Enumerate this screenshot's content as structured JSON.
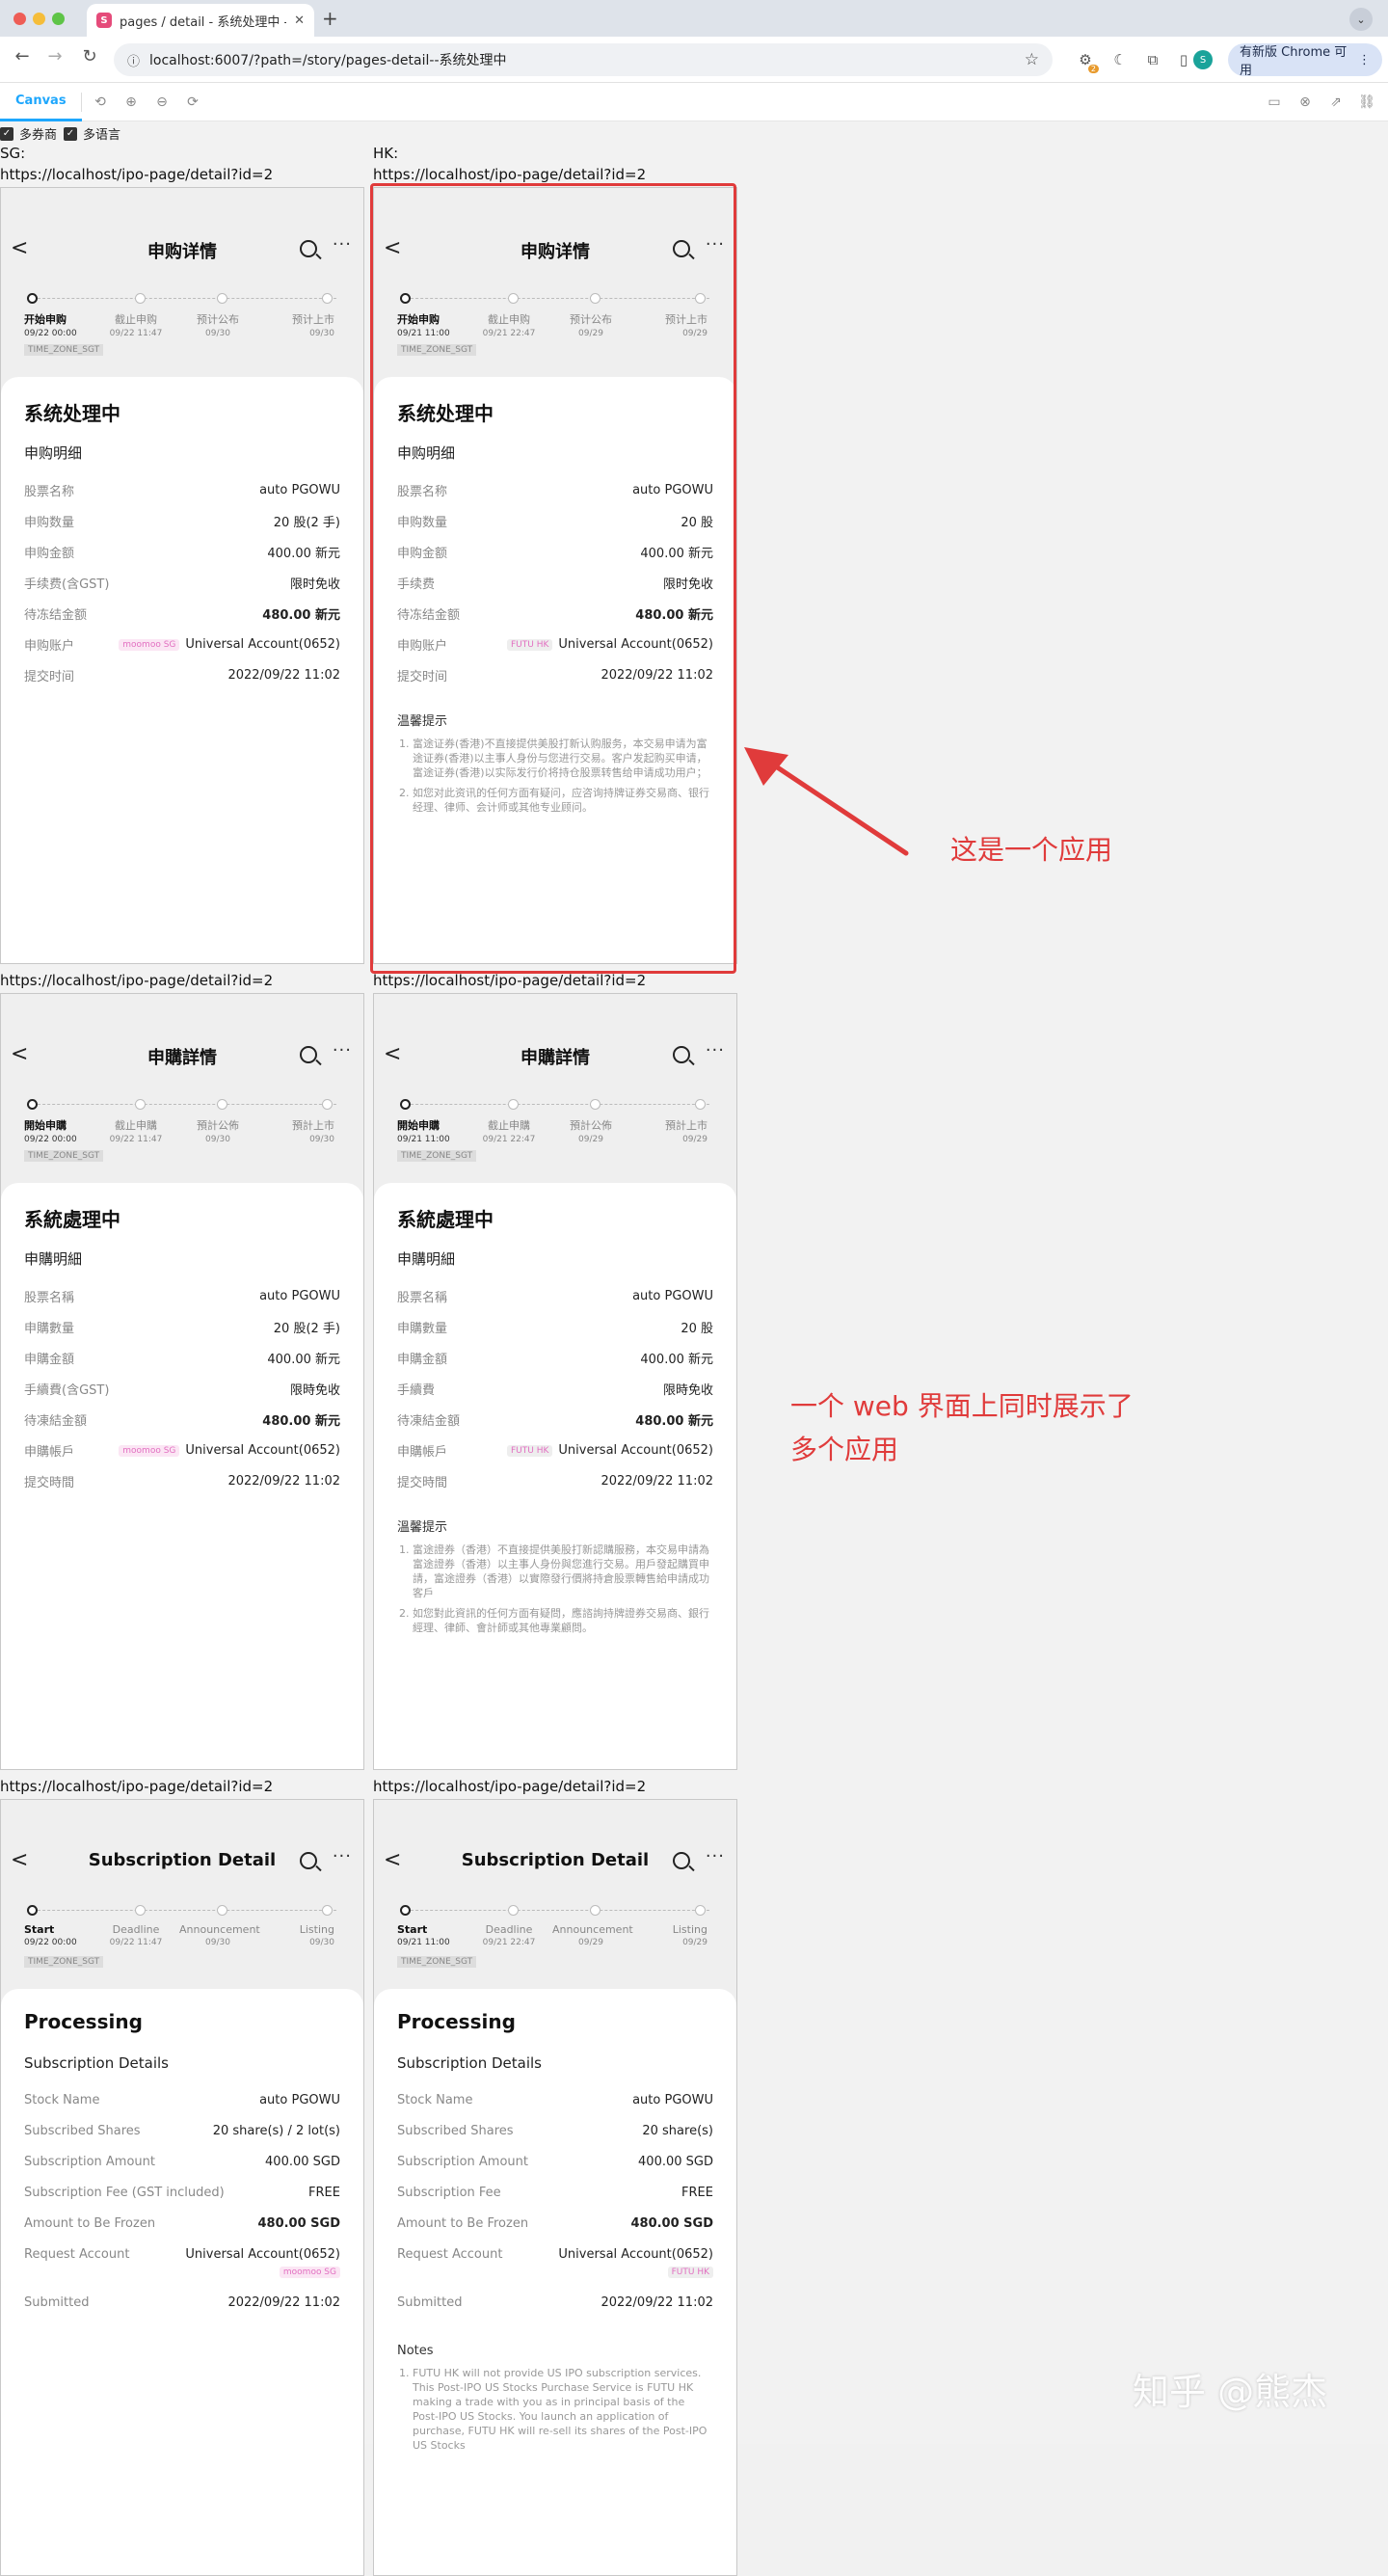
{
  "browser": {
    "tab_title": "pages / detail - 系统处理中 - S",
    "tab_favicon": "S",
    "url": "localhost:6007/?path=/story/pages-detail--系统处理中",
    "update_label": "有新版 Chrome 可用",
    "profile_initial": "S",
    "ext_badge": "2"
  },
  "storybook": {
    "canvas_tab": "Canvas"
  },
  "toggles": [
    {
      "label": "多券商",
      "checked": true
    },
    {
      "label": "多语言",
      "checked": true
    }
  ],
  "labels": {
    "sg": "SG:",
    "hk": "HK:",
    "url": "https://localhost/ipo-page/detail?id=2"
  },
  "frames": [
    {
      "title": "申购详情",
      "steps": [
        {
          "name": "开始申购",
          "date": "09/22 00:00"
        },
        {
          "name": "截止申购",
          "date": "09/22 11:47"
        },
        {
          "name": "预计公布",
          "date": "09/30"
        },
        {
          "name": "预计上市",
          "date": "09/30"
        }
      ],
      "tz": "TIME_ZONE_SGT",
      "status": "系统处理中",
      "section": "申购明细",
      "rows": [
        {
          "k": "股票名称",
          "v": "auto PGOWU"
        },
        {
          "k": "申购数量",
          "v": "20 股(2 手)"
        },
        {
          "k": "申购金额",
          "v": "400.00 新元"
        },
        {
          "k": "手续费(含GST)",
          "v": "限时免收"
        },
        {
          "k": "待冻结金额",
          "v": "480.00 新元",
          "bold": true
        },
        {
          "k": "申购账户",
          "v": "Universal Account(0652)",
          "badge": "moomoo SG"
        },
        {
          "k": "提交时间",
          "v": "2022/09/22 11:02"
        }
      ]
    },
    {
      "title": "申购详情",
      "steps": [
        {
          "name": "开始申购",
          "date": "09/21 11:00"
        },
        {
          "name": "截止申购",
          "date": "09/21 22:47"
        },
        {
          "name": "预计公布",
          "date": "09/29"
        },
        {
          "name": "预计上市",
          "date": "09/29"
        }
      ],
      "tz": "TIME_ZONE_SGT",
      "status": "系统处理中",
      "section": "申购明细",
      "rows": [
        {
          "k": "股票名称",
          "v": "auto PGOWU"
        },
        {
          "k": "申购数量",
          "v": "20 股"
        },
        {
          "k": "申购金额",
          "v": "400.00 新元"
        },
        {
          "k": "手续费",
          "v": "限时免收"
        },
        {
          "k": "待冻结金额",
          "v": "480.00 新元",
          "bold": true
        },
        {
          "k": "申购账户",
          "v": "Universal Account(0652)",
          "badge": "FUTU HK"
        },
        {
          "k": "提交时间",
          "v": "2022/09/22 11:02"
        }
      ],
      "tips_title": "温馨提示",
      "tips": [
        "富途证券(香港)不直接提供美股打新认购服务，本交易申请为富途证券(香港)以主事人身份与您进行交易。客户发起购买申请，富途证券(香港)以实际发行价将持仓股票转售给申请成功用户；",
        "如您对此资讯的任何方面有疑问，应咨询持牌证券交易商、银行经理、律师、会计师或其他专业顾问。"
      ]
    },
    {
      "title": "申購詳情",
      "steps": [
        {
          "name": "開始申購",
          "date": "09/22 00:00"
        },
        {
          "name": "截止申購",
          "date": "09/22 11:47"
        },
        {
          "name": "預計公佈",
          "date": "09/30"
        },
        {
          "name": "預計上市",
          "date": "09/30"
        }
      ],
      "tz": "TIME_ZONE_SGT",
      "status": "系統處理中",
      "section": "申購明細",
      "rows": [
        {
          "k": "股票名稱",
          "v": "auto PGOWU"
        },
        {
          "k": "申購數量",
          "v": "20 股(2 手)"
        },
        {
          "k": "申購金額",
          "v": "400.00 新元"
        },
        {
          "k": "手續費(含GST)",
          "v": "限時免收"
        },
        {
          "k": "待凍結金額",
          "v": "480.00 新元",
          "bold": true
        },
        {
          "k": "申購帳戶",
          "v": "Universal Account(0652)",
          "badge": "moomoo SG"
        },
        {
          "k": "提交時間",
          "v": "2022/09/22 11:02"
        }
      ]
    },
    {
      "title": "申購詳情",
      "steps": [
        {
          "name": "開始申購",
          "date": "09/21 11:00"
        },
        {
          "name": "截止申購",
          "date": "09/21 22:47"
        },
        {
          "name": "預計公佈",
          "date": "09/29"
        },
        {
          "name": "預計上市",
          "date": "09/29"
        }
      ],
      "tz": "TIME_ZONE_SGT",
      "status": "系統處理中",
      "section": "申購明細",
      "rows": [
        {
          "k": "股票名稱",
          "v": "auto PGOWU"
        },
        {
          "k": "申購數量",
          "v": "20 股"
        },
        {
          "k": "申購金額",
          "v": "400.00 新元"
        },
        {
          "k": "手續費",
          "v": "限時免收"
        },
        {
          "k": "待凍結金額",
          "v": "480.00 新元",
          "bold": true
        },
        {
          "k": "申購帳戶",
          "v": "Universal Account(0652)",
          "badge": "FUTU HK"
        },
        {
          "k": "提交時間",
          "v": "2022/09/22 11:02"
        }
      ],
      "tips_title": "溫馨提示",
      "tips": [
        "富途證券（香港）不直接提供美股打新認購服務，本交易申請為富途證券（香港）以主事人身份與您進行交易。用戶發起購買申請，富途證券（香港）以實際發行價將持倉股票轉售給申請成功客戶",
        "如您對此資訊的任何方面有疑問，應諮詢持牌證券交易商、銀行經理、律師、會計師或其他專業顧問。"
      ]
    },
    {
      "title": "Subscription Detail",
      "steps": [
        {
          "name": "Start",
          "date": "09/22 00:00"
        },
        {
          "name": "Deadline",
          "date": "09/22 11:47"
        },
        {
          "name": "Announcement",
          "date": "09/30"
        },
        {
          "name": "Listing",
          "date": "09/30"
        }
      ],
      "tz": "TIME_ZONE_SGT",
      "status": "Processing",
      "section": "Subscription Details",
      "rows": [
        {
          "k": "Stock Name",
          "v": "auto PGOWU"
        },
        {
          "k": "Subscribed Shares",
          "v": "20 share(s) / 2 lot(s)"
        },
        {
          "k": "Subscription Amount",
          "v": "400.00 SGD"
        },
        {
          "k": "Subscription Fee (GST included)",
          "v": "FREE"
        },
        {
          "k": "Amount to Be Frozen",
          "v": "480.00 SGD",
          "bold": true
        },
        {
          "k": "Request Account",
          "v": "Universal Account(0652)",
          "badge": "moomoo SG",
          "badge_below": true
        },
        {
          "k": "Submitted",
          "v": "2022/09/22 11:02"
        }
      ]
    },
    {
      "title": "Subscription Detail",
      "steps": [
        {
          "name": "Start",
          "date": "09/21 11:00"
        },
        {
          "name": "Deadline",
          "date": "09/21 22:47"
        },
        {
          "name": "Announcement",
          "date": "09/29"
        },
        {
          "name": "Listing",
          "date": "09/29"
        }
      ],
      "tz": "TIME_ZONE_SGT",
      "status": "Processing",
      "section": "Subscription Details",
      "rows": [
        {
          "k": "Stock Name",
          "v": "auto PGOWU"
        },
        {
          "k": "Subscribed Shares",
          "v": "20 share(s)"
        },
        {
          "k": "Subscription Amount",
          "v": "400.00 SGD"
        },
        {
          "k": "Subscription Fee",
          "v": "FREE"
        },
        {
          "k": "Amount to Be Frozen",
          "v": "480.00 SGD",
          "bold": true
        },
        {
          "k": "Request Account",
          "v": "Universal Account(0652)",
          "badge": "FUTU HK",
          "badge_below": true
        },
        {
          "k": "Submitted",
          "v": "2022/09/22 11:02"
        }
      ],
      "tips_title": "Notes",
      "tips": [
        "FUTU HK will not provide US IPO subscription services. This Post-IPO US Stocks Purchase Service is FUTU HK making a trade with you as in principal basis of the Post-IPO US Stocks. You launch an application of purchase, FUTU HK will re-sell its shares of the Post-IPO US Stocks"
      ]
    }
  ],
  "annotations": {
    "note1": "这是一个应用",
    "note2_line1": "一个 web 界面上同时展示了",
    "note2_line2": "多个应用",
    "color": "#e03b3b"
  },
  "watermark": "知乎 @熊杰"
}
